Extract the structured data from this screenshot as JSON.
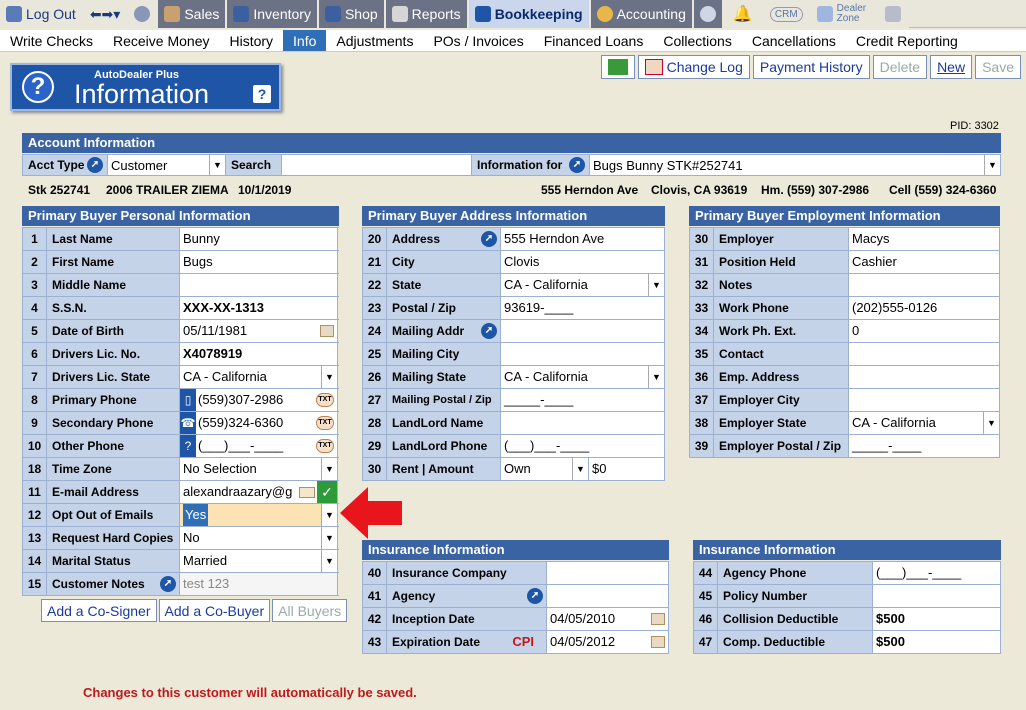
{
  "topnav": [
    {
      "label": "Log Out",
      "icon": "home-icon",
      "style": "lite"
    },
    {
      "label": "",
      "icon": "nav-arrows-icon",
      "style": "lite"
    },
    {
      "label": "",
      "icon": "face-icon",
      "style": "lite"
    },
    {
      "label": "Sales",
      "icon": "salesperson-icon",
      "style": ""
    },
    {
      "label": "Inventory",
      "icon": "car-icon",
      "style": ""
    },
    {
      "label": "Shop",
      "icon": "wrench-icon",
      "style": ""
    },
    {
      "label": "Reports",
      "icon": "report-icon",
      "style": ""
    },
    {
      "label": "Bookkeeping",
      "icon": "book-icon",
      "style": "act"
    },
    {
      "label": "Accounting",
      "icon": "pie-chart-icon",
      "style": ""
    },
    {
      "label": "",
      "icon": "gear-icon",
      "style": ""
    },
    {
      "label": "",
      "icon": "alarm-icon",
      "style": "lite"
    },
    {
      "label": "CRM",
      "icon": "crm-cloud-icon",
      "style": "lite"
    },
    {
      "label": "Dealer Zone",
      "icon": "dealer-zone-icon",
      "style": "lite"
    },
    {
      "label": "",
      "icon": "calculator-icon",
      "style": "lite"
    }
  ],
  "subnav": [
    "Write Checks",
    "Receive Money",
    "History",
    "Info",
    "Adjustments",
    "POs / Invoices",
    "Financed Loans",
    "Collections",
    "Cancellations",
    "Credit Reporting"
  ],
  "subnav_active": "Info",
  "toolbar": {
    "change_log": "Change Log",
    "payment_history": "Payment History",
    "delete": "Delete",
    "new": "New",
    "save": "Save"
  },
  "logo": {
    "small": "AutoDealer Plus",
    "big": "Information",
    "help": "?",
    "q": "?"
  },
  "pid": "PID: 3302",
  "account": {
    "title": "Account Information",
    "acct_type_label": "Acct Type",
    "acct_type": "Customer",
    "search_label": "Search",
    "search": "",
    "info_for_label": "Information for",
    "info_for": "Bugs Bunny STK#252741"
  },
  "strip": {
    "stock": "Stk 252741",
    "vehicle": "2006 TRAILER ZIEMA",
    "date": "10/1/2019",
    "address": "555 Herndon Ave",
    "city": "Clovis, CA 93619",
    "home": "Hm. (559) 307-2986",
    "cell": "Cell (559) 324-6360"
  },
  "personal": {
    "title": "Primary Buyer Personal Information",
    "rows": [
      {
        "n": "1",
        "l": "Last Name",
        "v": "Bunny"
      },
      {
        "n": "2",
        "l": "First Name",
        "v": "Bugs"
      },
      {
        "n": "3",
        "l": "Middle Name",
        "v": ""
      },
      {
        "n": "4",
        "l": "S.S.N.",
        "v": "XXX-XX-1313"
      },
      {
        "n": "5",
        "l": "Date of Birth",
        "v": "05/11/1981"
      },
      {
        "n": "6",
        "l": "Drivers Lic. No.",
        "v": "X4078919"
      },
      {
        "n": "7",
        "l": "Drivers Lic. State",
        "v": "CA - California"
      },
      {
        "n": "8",
        "l": "Primary Phone",
        "v": "(559)307-2986"
      },
      {
        "n": "9",
        "l": "Secondary Phone",
        "v": "(559)324-6360"
      },
      {
        "n": "10",
        "l": "Other Phone",
        "v": "(___)___-____"
      },
      {
        "n": "18",
        "l": "Time Zone",
        "v": "No Selection"
      },
      {
        "n": "11",
        "l": "E-mail Address",
        "v": "alexandraazary@g"
      },
      {
        "n": "12",
        "l": "Opt Out of Emails",
        "v": "Yes"
      },
      {
        "n": "13",
        "l": "Request Hard Copies",
        "v": "No"
      },
      {
        "n": "14",
        "l": "Marital Status",
        "v": "Married"
      },
      {
        "n": "15",
        "l": "Customer Notes",
        "v": "test 123"
      }
    ]
  },
  "address": {
    "title": "Primary Buyer Address Information",
    "rows": [
      {
        "n": "20",
        "l": "Address",
        "v": "555 Herndon Ave"
      },
      {
        "n": "21",
        "l": "City",
        "v": "Clovis"
      },
      {
        "n": "22",
        "l": "State",
        "v": "CA - California"
      },
      {
        "n": "23",
        "l": "Postal / Zip",
        "v": "93619-____"
      },
      {
        "n": "24",
        "l": "Mailing Addr",
        "v": ""
      },
      {
        "n": "25",
        "l": "Mailing City",
        "v": ""
      },
      {
        "n": "26",
        "l": "Mailing State",
        "v": "CA - California"
      },
      {
        "n": "27",
        "l": "Mailing Postal / Zip",
        "v": "_____-____"
      },
      {
        "n": "28",
        "l": "LandLord Name",
        "v": ""
      },
      {
        "n": "29",
        "l": "LandLord Phone",
        "v": "(___)___-____"
      },
      {
        "n": "30",
        "l": "Rent | Amount",
        "v": "Own",
        "v2": "$0"
      }
    ]
  },
  "employment": {
    "title": "Primary Buyer Employment Information",
    "rows": [
      {
        "n": "30",
        "l": "Employer",
        "v": "Macys"
      },
      {
        "n": "31",
        "l": "Position Held",
        "v": "Cashier"
      },
      {
        "n": "32",
        "l": "Notes",
        "v": ""
      },
      {
        "n": "33",
        "l": "Work Phone",
        "v": "(202)555-0126"
      },
      {
        "n": "34",
        "l": "Work Ph. Ext.",
        "v": "0"
      },
      {
        "n": "35",
        "l": "Contact",
        "v": ""
      },
      {
        "n": "36",
        "l": "Emp. Address",
        "v": ""
      },
      {
        "n": "37",
        "l": "Employer City",
        "v": ""
      },
      {
        "n": "38",
        "l": "Employer State",
        "v": "CA - California"
      },
      {
        "n": "39",
        "l": "Employer Postal / Zip",
        "v": "_____-____"
      }
    ]
  },
  "insurance1": {
    "title": "Insurance Information",
    "rows": [
      {
        "n": "40",
        "l": "Insurance Company",
        "v": ""
      },
      {
        "n": "41",
        "l": "Agency",
        "v": ""
      },
      {
        "n": "42",
        "l": "Inception Date",
        "v": "04/05/2010"
      },
      {
        "n": "43",
        "l": "Expiration Date",
        "v": "04/05/2012"
      }
    ],
    "cpi": "CPI"
  },
  "insurance2": {
    "title": "Insurance Information",
    "rows": [
      {
        "n": "44",
        "l": "Agency Phone",
        "v": "(___)___-____"
      },
      {
        "n": "45",
        "l": "Policy Number",
        "v": ""
      },
      {
        "n": "46",
        "l": "Collision Deductible",
        "v": "$500"
      },
      {
        "n": "47",
        "l": "Comp. Deductible",
        "v": "$500"
      }
    ]
  },
  "buttons": {
    "cosigner": "Add a Co-Signer",
    "cobuyer": "Add a Co-Buyer",
    "allbuyers": "All Buyers"
  },
  "note": "Changes to this customer will automatically be saved.",
  "accent": "#3a63a3"
}
